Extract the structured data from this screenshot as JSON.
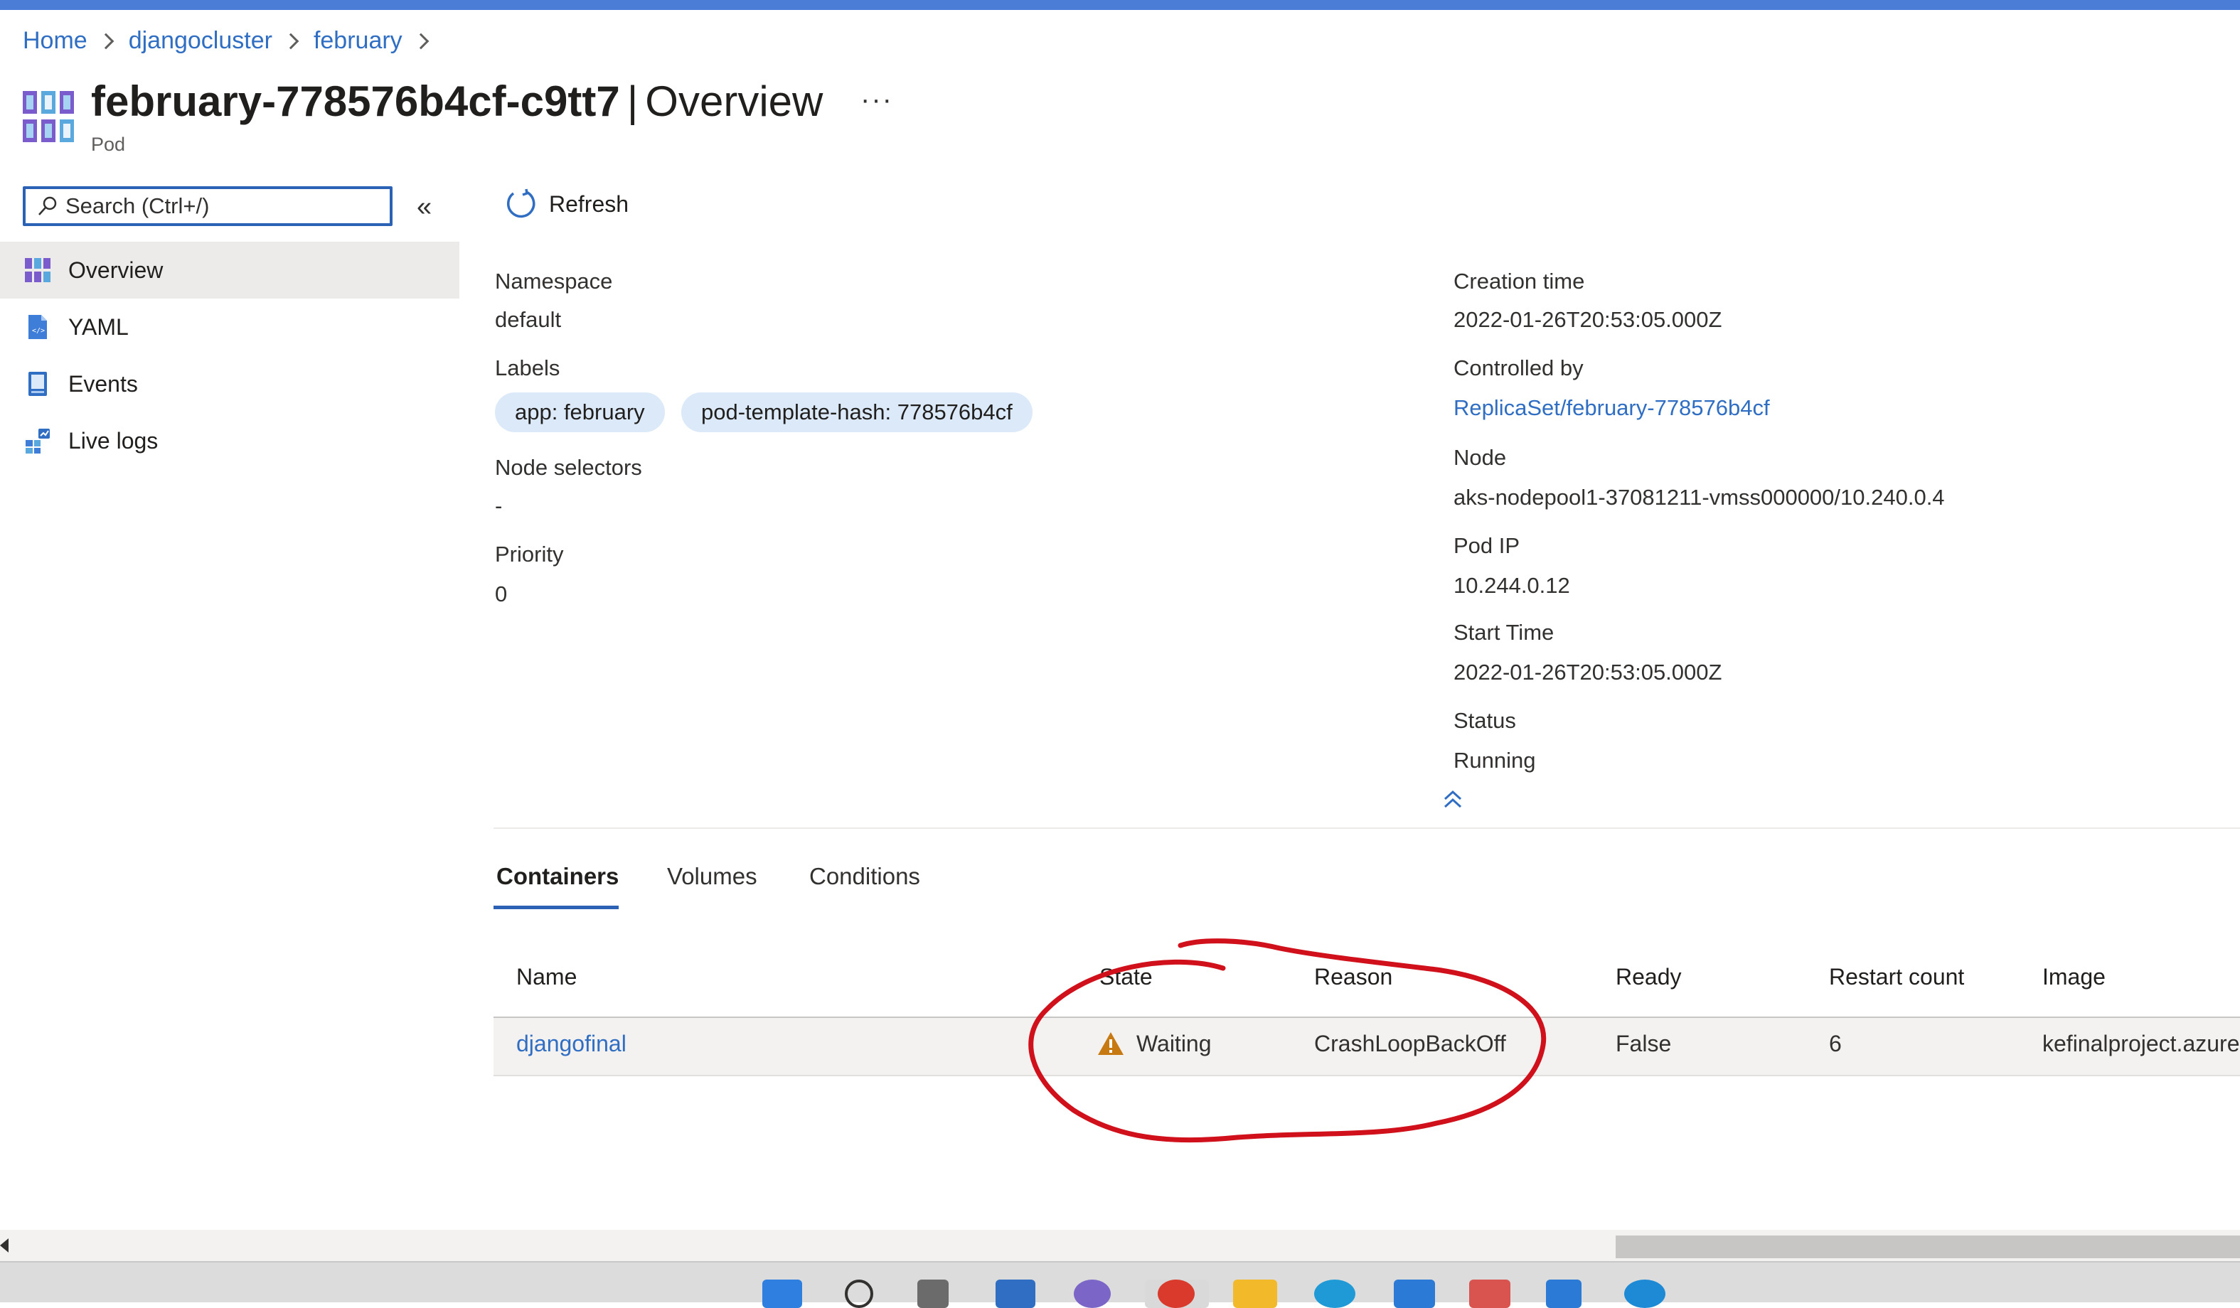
{
  "breadcrumb": {
    "items": [
      "Home",
      "djangocluster",
      "february"
    ]
  },
  "header": {
    "name": "february-778576b4cf-c9tt7",
    "separator": "|",
    "section": "Overview",
    "more": "···",
    "subtitle": "Pod"
  },
  "sidebar": {
    "search_placeholder": "Search (Ctrl+/)",
    "collapse": "«",
    "items": [
      {
        "label": "Overview",
        "icon": "pod-icon",
        "active": true
      },
      {
        "label": "YAML",
        "icon": "yaml-file-icon"
      },
      {
        "label": "Events",
        "icon": "events-book-icon"
      },
      {
        "label": "Live logs",
        "icon": "live-logs-icon"
      }
    ]
  },
  "toolbar": {
    "refresh_label": "Refresh"
  },
  "properties": {
    "left": {
      "namespace_label": "Namespace",
      "namespace_value": "default",
      "labels_label": "Labels",
      "tags": [
        "app: february",
        "pod-template-hash: 778576b4cf"
      ],
      "node_selectors_label": "Node selectors",
      "node_selectors_value": "-",
      "priority_label": "Priority",
      "priority_value": "0"
    },
    "right": {
      "creation_time_label": "Creation time",
      "creation_time_value": "2022-01-26T20:53:05.000Z",
      "controlled_by_label": "Controlled by",
      "controlled_by_value": "ReplicaSet/february-778576b4cf",
      "node_label": "Node",
      "node_value": "aks-nodepool1-37081211-vmss000000/10.240.0.4",
      "pod_ip_label": "Pod IP",
      "pod_ip_value": "10.244.0.12",
      "start_time_label": "Start Time",
      "start_time_value": "2022-01-26T20:53:05.000Z",
      "status_label": "Status",
      "status_value": "Running"
    }
  },
  "tabs": [
    "Containers",
    "Volumes",
    "Conditions"
  ],
  "table": {
    "columns": [
      "Name",
      "State",
      "Reason",
      "Ready",
      "Restart count",
      "Image"
    ],
    "rows": [
      {
        "name": "djangofinal",
        "state": "Waiting",
        "reason": "CrashLoopBackOff",
        "ready": "False",
        "restart_count": "6",
        "image": "kefinalproject.azure"
      }
    ]
  },
  "colors": {
    "accent": "#2c62b5",
    "link": "#2f6ec2",
    "top_bar": "#4c7dd6",
    "warning": "#c77a12",
    "annotation": "#d0101a"
  }
}
